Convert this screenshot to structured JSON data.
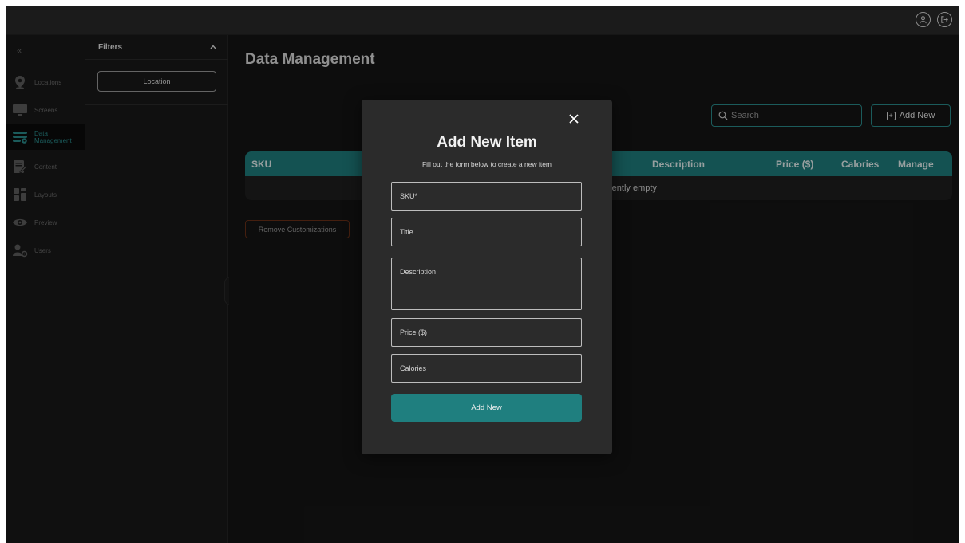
{
  "topbar": {
    "icons": [
      "user-icon",
      "logout-icon"
    ]
  },
  "nav": {
    "collapse_glyph": "«",
    "items": [
      {
        "label": "Locations",
        "icon": "location-pin-icon",
        "active": false
      },
      {
        "label": "Screens",
        "icon": "monitor-icon",
        "active": false
      },
      {
        "label": "Data\nManagement",
        "icon": "data-management-icon",
        "active": true
      },
      {
        "label": "Content",
        "icon": "content-edit-icon",
        "active": false
      },
      {
        "label": "Layouts",
        "icon": "layouts-icon",
        "active": false
      },
      {
        "label": "Preview",
        "icon": "eye-icon",
        "active": false
      },
      {
        "label": "Users",
        "icon": "users-gear-icon",
        "active": false
      }
    ]
  },
  "filters": {
    "title": "Filters",
    "location_button": "Location"
  },
  "main": {
    "title": "Data Management",
    "search_placeholder": "Search",
    "add_new_label": "Add New",
    "table": {
      "columns": [
        "SKU",
        "Description",
        "Price ($)",
        "Calories",
        "Manage"
      ],
      "empty_message": "rently empty"
    },
    "remove_customizations_label": "Remove Customizations"
  },
  "modal": {
    "title": "Add New Item",
    "subtitle": "Fill out the form below to create a new item",
    "fields": {
      "sku_placeholder": "SKU*",
      "title_placeholder": "Title",
      "description_placeholder": "Description",
      "price_placeholder": "Price ($)",
      "calories_placeholder": "Calories"
    },
    "submit_label": "Add New"
  },
  "colors": {
    "accent": "#1f7f7f",
    "accent_text": "#2a8d8d",
    "background": "#151515",
    "modal": "#2b2b2b",
    "danger_border": "#6b3018"
  }
}
